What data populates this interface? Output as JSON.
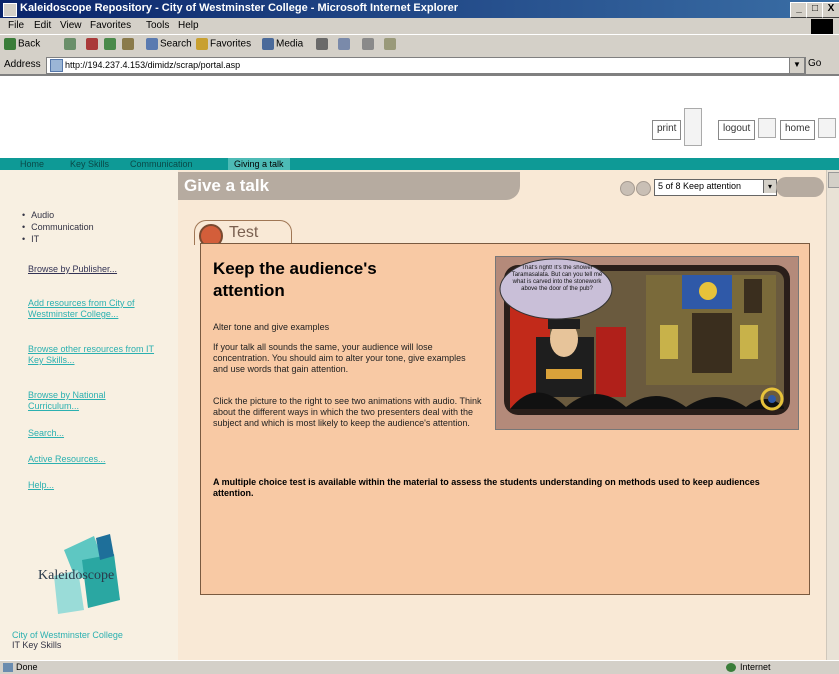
{
  "window": {
    "title": "Kaleidoscope Repository - City of Westminster College - Microsoft Internet Explorer",
    "min_label": "_",
    "max_label": "□",
    "close_label": "X"
  },
  "menu": [
    "File",
    "Edit",
    "View",
    "Favorites",
    "Tools",
    "Help"
  ],
  "toolbar": {
    "back": "Back",
    "search": "Search",
    "favorites": "Favorites",
    "media": "Media"
  },
  "address": {
    "label": "Address",
    "url": "http://194.237.4.153/dimidz/scrap/portal.asp",
    "go_label": "Go"
  },
  "header": {
    "print": "print",
    "logout": "logout",
    "home": "home"
  },
  "nav": {
    "crumbs": [
      "Home",
      "Key Skills",
      "Communication"
    ],
    "current": "Giving a talk"
  },
  "sidebar": {
    "bullets": [
      "Audio",
      "Communication",
      "IT"
    ],
    "links": [
      "Browse by Publisher...",
      "Add resources from City of Westminster College...",
      "Browse other resources from IT Key Skills...",
      "Browse by National Curriculum...",
      "Search...",
      "Active Resources...",
      "Help..."
    ],
    "logo_text": "Kaleidoscope",
    "footer": [
      "City of Westminster College",
      "IT Key Skills"
    ]
  },
  "main": {
    "tab_title": "Give a talk",
    "step_select": "5 of 8 Keep attention",
    "step_arrow": "▾",
    "test_label": "Test",
    "content_title": "Keep the audience's attention",
    "paragraphs": [
      "Alter tone and give examples",
      "If your talk all sounds the same, your audience will lose concentration. You should aim to alter your tone, give examples and use words that gain attention.",
      "Click the picture to the right to see two animations with audio. Think about the different ways in which the two presenters deal with the subject and which is most likely to keep the audience's attention."
    ],
    "bold_paragraph": "A multiple choice test is available within the material to assess the students understanding on methods used to keep audiences attention.",
    "speech_bubble": "That's right! It's the shower Taramasalata. But can you tell me what is carved into the stonework above the door of the pub?"
  },
  "status": {
    "left": "Done",
    "zone": "Internet"
  },
  "colors": {
    "teal": "#0e9a96",
    "main_bg": "#f9e9d6",
    "content_bg": "#f8c9a4",
    "tab_grey": "#b6aba0"
  }
}
